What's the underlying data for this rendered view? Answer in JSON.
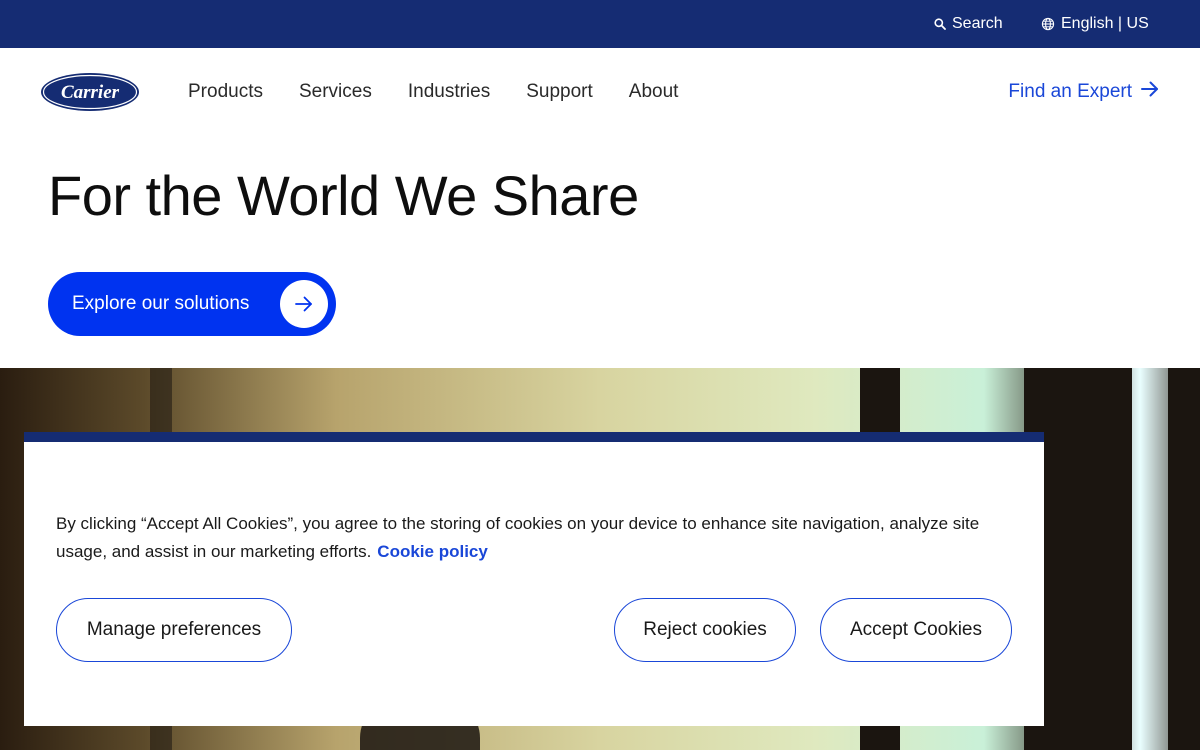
{
  "topbar": {
    "search_label": "Search",
    "language_label": "English | US"
  },
  "brand": {
    "logo_text": "Carrier",
    "colors": {
      "navy": "#152c73",
      "accent_blue": "#0033f0",
      "link_blue": "#1a47d8"
    }
  },
  "nav": {
    "items": [
      {
        "label": "Products"
      },
      {
        "label": "Services"
      },
      {
        "label": "Industries"
      },
      {
        "label": "Support"
      },
      {
        "label": "About"
      }
    ],
    "cta_label": "Find an Expert"
  },
  "hero": {
    "title": "For the World We Share",
    "button_label": "Explore our solutions"
  },
  "cookie_banner": {
    "text": "By clicking “Accept All Cookies”, you agree to the storing of cookies on your device to enhance site navigation, analyze site usage, and assist in our marketing efforts.",
    "link_label": "Cookie policy",
    "manage_label": "Manage preferences",
    "reject_label": "Reject cookies",
    "accept_label": "Accept Cookies"
  },
  "icons": [
    "search-icon",
    "globe-icon",
    "arrow-right-icon"
  ]
}
